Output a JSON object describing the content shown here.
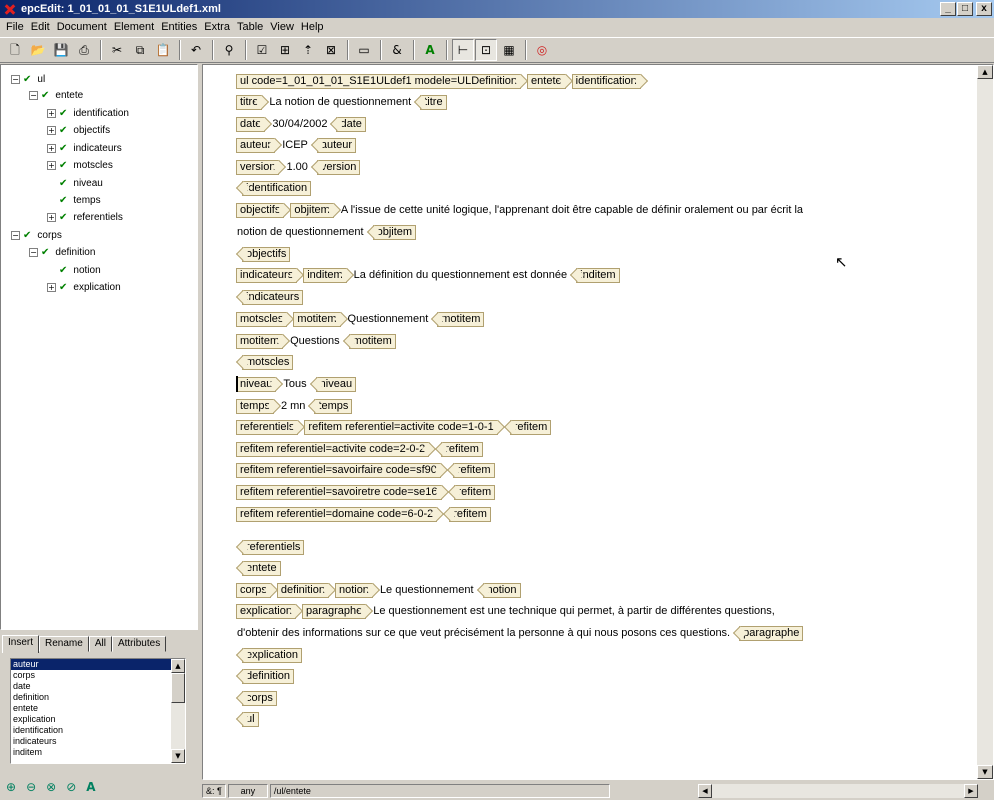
{
  "window": {
    "title": "epcEdit: 1_01_01_01_S1E1ULdef1.xml",
    "min": "_",
    "max": "□",
    "close": "x"
  },
  "menu": [
    "File",
    "Edit",
    "Document",
    "Element",
    "Entities",
    "Extra",
    "Table",
    "View",
    "Help"
  ],
  "tree": [
    {
      "label": "ul",
      "level": 0,
      "exp": "−"
    },
    {
      "label": "entete",
      "level": 1,
      "exp": "−"
    },
    {
      "label": "identification",
      "level": 2,
      "exp": "+"
    },
    {
      "label": "objectifs",
      "level": 2,
      "exp": "+"
    },
    {
      "label": "indicateurs",
      "level": 2,
      "exp": "+"
    },
    {
      "label": "motscles",
      "level": 2,
      "exp": "+"
    },
    {
      "label": "niveau",
      "level": 2,
      "exp": ""
    },
    {
      "label": "temps",
      "level": 2,
      "exp": ""
    },
    {
      "label": "referentiels",
      "level": 2,
      "exp": "+"
    },
    {
      "label": "corps",
      "level": 0,
      "exp": "−"
    },
    {
      "label": "definition",
      "level": 1,
      "exp": "−"
    },
    {
      "label": "notion",
      "level": 2,
      "exp": ""
    },
    {
      "label": "explication",
      "level": 2,
      "exp": "+"
    }
  ],
  "tabs": [
    "Insert",
    "Rename",
    "All",
    "Attributes"
  ],
  "insert_list": [
    "auteur",
    "corps",
    "date",
    "definition",
    "entete",
    "explication",
    "identification",
    "indicateurs",
    "inditem"
  ],
  "doc": {
    "l1": [
      "ul code=1_01_01_01_S1E1ULdef1 modele=ULDefinition",
      "entete",
      "identification"
    ],
    "l2": [
      "titre",
      "La notion de questionnement",
      "titre"
    ],
    "l3": [
      "date",
      "30/04/2002",
      "date"
    ],
    "l4": [
      "auteur",
      "ICEP",
      "auteur"
    ],
    "l5": [
      "version",
      "1.00",
      "version"
    ],
    "l6": "identification",
    "l7": [
      "objectifs",
      "objitem",
      "A l'issue de cette unité logique, l'apprenant doit être capable de définir oralement ou par écrit la"
    ],
    "l8": [
      "notion de questionnement",
      "objitem"
    ],
    "l9": "objectifs",
    "l10": [
      "indicateurs",
      "inditem",
      "La définition du questionnement est donnée",
      "inditem"
    ],
    "l11": "indicateurs",
    "l12": [
      "motscles",
      "motitem",
      "Questionnement",
      "motitem"
    ],
    "l13": [
      "motitem",
      "Questions",
      "motitem"
    ],
    "l14": "motscles",
    "l15": [
      "niveau",
      "Tous",
      "niveau"
    ],
    "l16": [
      "temps",
      "2 mn",
      "temps"
    ],
    "l17": [
      "referentiels",
      "refitem referentiel=activite code=1-0-1",
      "refitem"
    ],
    "l18": [
      "refitem referentiel=activite code=2-0-2",
      "refitem"
    ],
    "l19": [
      "refitem referentiel=savoirfaire code=sf90",
      "refitem"
    ],
    "l20": [
      "refitem referentiel=savoiretre code=se16",
      "refitem"
    ],
    "l21": [
      "refitem referentiel=domaine code=6-0-2",
      "refitem"
    ],
    "l22": "referentiels",
    "l23": "entete",
    "l24": [
      "corps",
      "definition",
      "notion",
      "Le questionnement",
      "notion"
    ],
    "l25": [
      "explication",
      "paragraphe",
      "Le questionnement est une technique qui permet, à partir de différentes questions,"
    ],
    "l26": [
      "d'obtenir des informations sur ce que veut précisément la personne à qui nous posons ces questions.",
      "paragraphe"
    ],
    "l27": "explication",
    "l28": "definition",
    "l29": "corps",
    "l30": "ul"
  },
  "status": {
    "mode": "any",
    "path": "/ul/entete",
    "icons": "&: ¶"
  },
  "colors": {
    "title_start": "#0a246a",
    "title_end": "#a6caf0",
    "tag_fill": "#f6f0d8",
    "tag_border": "#b0a070",
    "check": "#008000"
  }
}
